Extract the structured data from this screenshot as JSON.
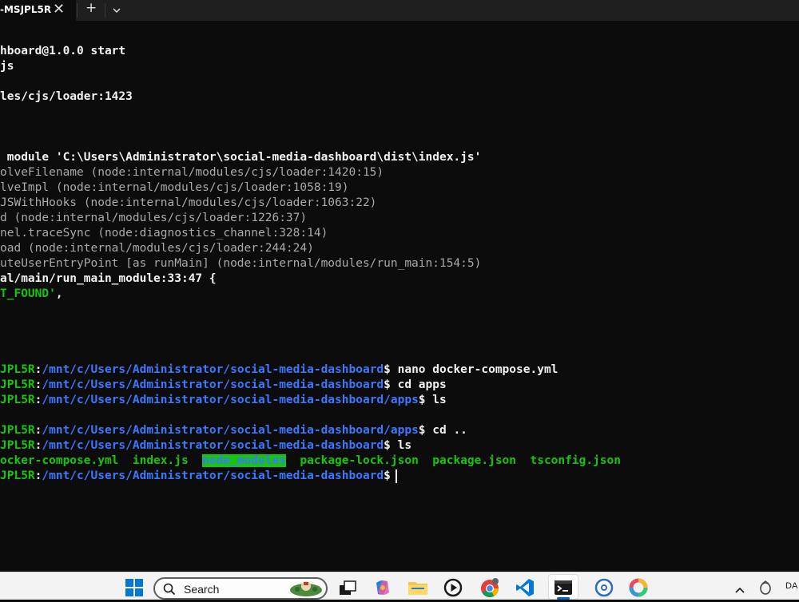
{
  "window": {
    "tab_title": "-MSJPL5R",
    "close_glyph": "✕",
    "new_tab_glyph": "+"
  },
  "terminal": {
    "lines": [
      {
        "segments": [
          {
            "t": "hboard@1.0.0 start",
            "c": "bright"
          }
        ]
      },
      {
        "segments": [
          {
            "t": "js",
            "c": "bright"
          }
        ]
      },
      {
        "segments": [
          {
            "t": "les/cjs/loader:1423",
            "c": "bright"
          }
        ]
      },
      {
        "segments": [
          {
            "t": " module 'C:\\Users\\Administrator\\social-media-dashboard\\dist\\index.js'",
            "c": "bright"
          }
        ]
      },
      {
        "segments": [
          {
            "t": "olveFilename (node:internal/modules/cjs/loader:1420:15)",
            "c": "dim"
          }
        ]
      },
      {
        "segments": [
          {
            "t": "lveImpl (node:internal/modules/cjs/loader:1058:19)",
            "c": "dim"
          }
        ]
      },
      {
        "segments": [
          {
            "t": "JSWithHooks (node:internal/modules/cjs/loader:1063:22)",
            "c": "dim"
          }
        ]
      },
      {
        "segments": [
          {
            "t": "d (node:internal/modules/cjs/loader:1226:37)",
            "c": "dim"
          }
        ]
      },
      {
        "segments": [
          {
            "t": "nel.traceSync (node:diagnostics_channel:328:14)",
            "c": "dim"
          }
        ]
      },
      {
        "segments": [
          {
            "t": "oad (node:internal/modules/cjs/loader:244:24)",
            "c": "dim"
          }
        ]
      },
      {
        "segments": [
          {
            "t": "uteUserEntryPoint [as runMain] (node:internal/modules/run_main:154:5)",
            "c": "dim"
          }
        ]
      },
      {
        "segments": [
          {
            "t": "al/main/run_main_module:33:47 {",
            "c": "bright"
          }
        ]
      },
      {
        "segments": [
          {
            "t": "T_FOUND'",
            "c": "green"
          },
          {
            "t": ",",
            "c": "bright"
          }
        ]
      },
      {
        "segments": [
          {
            "t": "JPL5R",
            "c": "green"
          },
          {
            "t": ":",
            "c": "white"
          },
          {
            "t": "/mnt/c/Users/Administrator/social-media-dashboard",
            "c": "blue"
          },
          {
            "t": "$ nano docker-compose.yml",
            "c": "white"
          }
        ]
      },
      {
        "segments": [
          {
            "t": "JPL5R",
            "c": "green"
          },
          {
            "t": ":",
            "c": "white"
          },
          {
            "t": "/mnt/c/Users/Administrator/social-media-dashboard",
            "c": "blue"
          },
          {
            "t": "$ cd apps",
            "c": "white"
          }
        ]
      },
      {
        "segments": [
          {
            "t": "JPL5R",
            "c": "green"
          },
          {
            "t": ":",
            "c": "white"
          },
          {
            "t": "/mnt/c/Users/Administrator/social-media-dashboard/apps",
            "c": "blue"
          },
          {
            "t": "$ ls",
            "c": "white"
          }
        ]
      },
      {
        "segments": [
          {
            "t": "JPL5R",
            "c": "green"
          },
          {
            "t": ":",
            "c": "white"
          },
          {
            "t": "/mnt/c/Users/Administrator/social-media-dashboard/apps",
            "c": "blue"
          },
          {
            "t": "$ cd ..",
            "c": "white"
          }
        ]
      },
      {
        "segments": [
          {
            "t": "JPL5R",
            "c": "green"
          },
          {
            "t": ":",
            "c": "white"
          },
          {
            "t": "/mnt/c/Users/Administrator/social-media-dashboard",
            "c": "blue"
          },
          {
            "t": "$ ls",
            "c": "white"
          }
        ]
      },
      {
        "segments": [
          {
            "t": "ocker-compose.yml  index.js  ",
            "c": "green"
          },
          {
            "t": "node_modules",
            "c": "hl"
          },
          {
            "t": "  package-lock.json  package.json  tsconfig.json",
            "c": "green"
          }
        ]
      },
      {
        "segments": [
          {
            "t": "JPL5R",
            "c": "green"
          },
          {
            "t": ":",
            "c": "white"
          },
          {
            "t": "/mnt/c/Users/Administrator/social-media-dashboard",
            "c": "blue"
          },
          {
            "t": "$",
            "c": "white"
          }
        ],
        "cursor": true
      }
    ]
  },
  "taskbar": {
    "search_placeholder": "Search",
    "apps": [
      "windows-start-icon",
      "task-view-icon",
      "copilot-icon",
      "file-explorer-icon",
      "media-player-icon",
      "chrome-icon",
      "vscode-icon",
      "terminal-icon",
      "pokeball-app-icon",
      "colorful-ring-app-icon"
    ],
    "tray_chevron": "^",
    "tray_text": "DA"
  },
  "colors": {
    "terminal_bg": "#0c0c0c",
    "prompt_user": "#16c60c",
    "prompt_path": "#3b78ff",
    "taskbar_bg": "#f3f3f3"
  }
}
